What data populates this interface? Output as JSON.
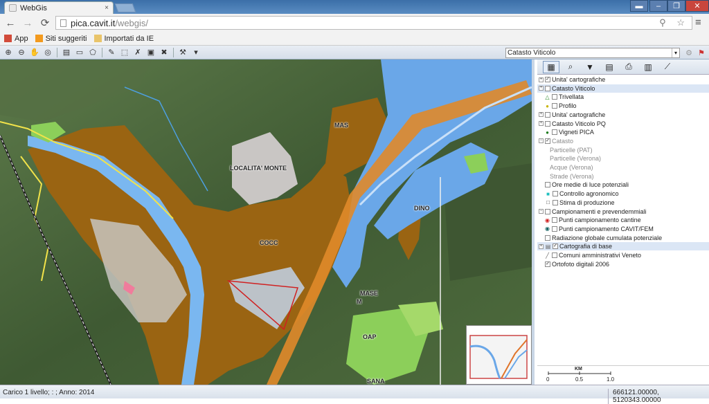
{
  "browser": {
    "tab_title": "WebGis",
    "tab_close": "×",
    "address_host": "pica.cavit.it",
    "address_path": "/webgis/",
    "nav_back": "←",
    "nav_forward": "→",
    "nav_reload": "⟳",
    "search_star": "⚲ ☆",
    "menu": "≡",
    "window_user": "▬",
    "window_min": "–",
    "window_max": "❐",
    "window_close": "✕"
  },
  "bookmarks": [
    {
      "label": "App",
      "icon": "apps-grid-icon",
      "color": "#d24b3a"
    },
    {
      "label": "Siti suggeriti",
      "icon": "suggested-sites-icon",
      "color": "#f39a1e"
    },
    {
      "label": "Importati da IE",
      "icon": "folder-icon",
      "color": "#e9c46a"
    }
  ],
  "toolbar": {
    "layer_select": "Catasto Viticolo",
    "select_arrow": "▾",
    "tools": [
      {
        "name": "zoom-in-icon",
        "glyph": "⊕"
      },
      {
        "name": "zoom-out-icon",
        "glyph": "⊖"
      },
      {
        "name": "pan-hand-icon",
        "glyph": "✋"
      },
      {
        "name": "zoom-extent-icon",
        "glyph": "◎"
      },
      {
        "name": "layer-info-icon",
        "glyph": "▤"
      },
      {
        "name": "tooltip-icon",
        "glyph": "▭"
      },
      {
        "name": "select-polygon-icon",
        "glyph": "⬠"
      },
      {
        "name": "draw-line-icon",
        "glyph": "✎"
      },
      {
        "name": "draw-shape-icon",
        "glyph": "⬚"
      },
      {
        "name": "erase-icon",
        "glyph": "✗"
      },
      {
        "name": "save-icon",
        "glyph": "▣"
      },
      {
        "name": "delete-icon",
        "glyph": "✖"
      },
      {
        "name": "measure-icon",
        "glyph": "⚒"
      },
      {
        "name": "measure-dropdown-icon",
        "glyph": "▾"
      }
    ],
    "right_tool_1": "⚙",
    "right_tool_2": "⚑"
  },
  "map_labels": {
    "label_1": "LOCALITA' MONTE",
    "label_2": "MAS",
    "label_3": "DINO",
    "label_4": "COCC",
    "label_5": "MASE",
    "label_6": "M",
    "label_7": "OAP",
    "label_8": "SANA"
  },
  "panel": {
    "tools": [
      {
        "name": "layers-tab-icon",
        "glyph": "▦",
        "selected": true
      },
      {
        "name": "search-tab-icon",
        "glyph": "⌕"
      },
      {
        "name": "filter-tab-icon",
        "glyph": "▼"
      },
      {
        "name": "table-tab-icon",
        "glyph": "▤"
      },
      {
        "name": "print-tab-icon",
        "glyph": "⎙"
      },
      {
        "name": "chart-tab-icon",
        "glyph": "▥"
      },
      {
        "name": "profile-tab-icon",
        "glyph": "⟋"
      }
    ],
    "scale_title": "KM",
    "scale_0": "0",
    "scale_05": "0.5",
    "scale_10": "1.0"
  },
  "layers": [
    {
      "label": "Unita' cartografiche",
      "expander": "+",
      "checked": true
    },
    {
      "label": "Catasto Viticolo",
      "expander": "+",
      "checked": false,
      "highlight": true
    },
    {
      "label": "Trivellata",
      "checked": false,
      "symbol": "△",
      "symbol_color": "#2a8a2a",
      "indent": 1
    },
    {
      "label": "Profilo",
      "checked": false,
      "symbol": "●",
      "symbol_color": "#c8b400",
      "indent": 1
    },
    {
      "label": "Unita' cartografiche",
      "expander": "+",
      "checked": false
    },
    {
      "label": "Catasto Viticolo PQ",
      "expander": "+",
      "checked": false
    },
    {
      "label": "Vigneti PICA",
      "checked": false,
      "symbol": "●",
      "symbol_color": "#1a7a1a",
      "indent": 1
    },
    {
      "label": "Catasto",
      "expander": "−",
      "checked": true,
      "disabled": true
    },
    {
      "label": "Particelle (PAT)",
      "indent": 2,
      "disabled": true
    },
    {
      "label": "Particelle (Verona)",
      "indent": 2,
      "disabled": true
    },
    {
      "label": "Acque (Verona)",
      "indent": 2,
      "disabled": true
    },
    {
      "label": "Strade (Verona)",
      "indent": 2,
      "disabled": true
    },
    {
      "label": "Ore medie di luce potenziali",
      "checked": false
    },
    {
      "label": "Controllo agronomico",
      "checked": false,
      "symbol": "■",
      "symbol_color": "#20c0c0"
    },
    {
      "label": "Stima di produzione",
      "checked": false,
      "symbol": "□",
      "symbol_color": "#333333"
    },
    {
      "label": "Campionamenti e prevendemmiali",
      "expander": "−",
      "checked": false
    },
    {
      "label": "Punti campionamento cantine",
      "checked": false,
      "symbol": "◉",
      "symbol_color": "#d02020",
      "indent": 1
    },
    {
      "label": "Punti campionamento CAVIT/FEM",
      "checked": false,
      "symbol": "◉",
      "symbol_color": "#106060",
      "indent": 1
    },
    {
      "label": "Radiazione globale cumulata potenziale",
      "checked": false
    },
    {
      "label": "Cartografia di base",
      "expander": "+",
      "checked": true,
      "highlight": true,
      "symbol": "▤",
      "symbol_color": "#666666"
    },
    {
      "label": "Comuni amministrativi Veneto",
      "checked": false,
      "symbol": "╱",
      "symbol_color": "#666666",
      "indent": 1
    },
    {
      "label": "Ortofoto digitali 2006",
      "checked": true
    }
  ],
  "status": {
    "left": "Carico 1 livello; : ; Anno: 2014",
    "coords": "666121.00000, 5120343.00000"
  }
}
